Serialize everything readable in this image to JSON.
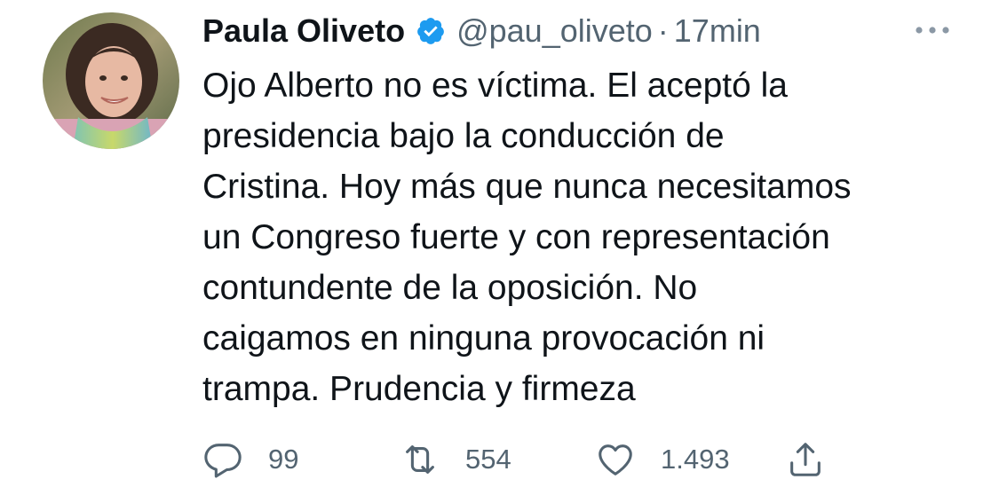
{
  "tweet": {
    "author": {
      "display_name": "Paula Oliveto",
      "handle": "@pau_oliveto",
      "verified": true
    },
    "separator": "·",
    "timestamp": "17min",
    "text": "Ojo Alberto no es víctima. El aceptó la\npresidencia bajo la conducción de\nCristina. Hoy más que nunca necesitamos\nun Congreso fuerte y con representación\ncontundente de la oposición. No\ncaigamos en ninguna provocación ni\ntrampa. Prudencia y firmeza",
    "stats": {
      "replies": "99",
      "retweets": "554",
      "likes": "1.493"
    }
  },
  "icons": {
    "verified": "verified-badge-icon",
    "more": "more-dots-icon",
    "reply": "reply-bubble-icon",
    "retweet": "retweet-arrows-icon",
    "like": "heart-icon",
    "share": "share-upload-icon"
  },
  "colors": {
    "text_primary": "#0f1419",
    "text_secondary": "#536471",
    "verified_blue": "#1d9bf0",
    "background": "#ffffff"
  }
}
